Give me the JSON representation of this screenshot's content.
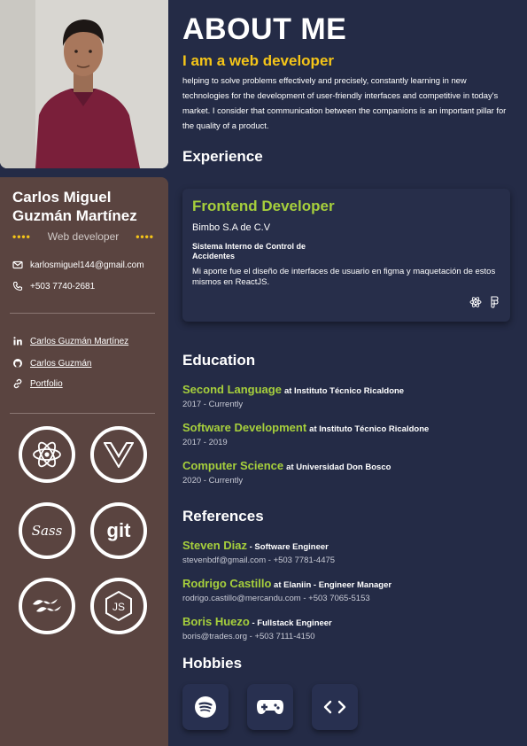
{
  "profile": {
    "name": "Carlos Miguel Guzmán Martínez",
    "role": "Web developer",
    "dots": "••••",
    "email": "karlosmiguel144@gmail.com",
    "phone": "+503 7740-2681"
  },
  "links": {
    "linkedin": "Carlos Guzmán Martínez",
    "github": "Carlos Guzmán",
    "portfolio": "Portfolio"
  },
  "tech_icons": [
    "react-icon",
    "vue-icon",
    "sass-icon",
    "git-icon",
    "tailwind-icon",
    "nodejs-icon"
  ],
  "about": {
    "title": "ABOUT ME",
    "tagline": "I am a web developer",
    "text": "helping to solve problems effectively and precisely, constantly learning in new technologies for the development of user-friendly interfaces and competitive in today's market. I consider that communication between the companions is an important pillar for the quality of a product."
  },
  "experience": {
    "title": "Experience",
    "job_title": "Frontend Developer",
    "company": "Bimbo S.A de C.V",
    "project": "Sistema Interno de Control de Accidentes",
    "description": "Mi aporte fue el diseño de interfaces de usuario en figma y maquetación de estos mismos en ReactJS."
  },
  "education": {
    "title": "Education",
    "items": [
      {
        "title": "Second Language",
        "at": "at Instituto Técnico Ricaldone",
        "dates": "2017 - Currently"
      },
      {
        "title": "Software Development",
        "at": "at Instituto Técnico Ricaldone",
        "dates": "2017 - 2019"
      },
      {
        "title": "Computer Science",
        "at": "at Universidad Don Bosco",
        "dates": "2020 - Currently"
      }
    ]
  },
  "references": {
    "title": "References",
    "items": [
      {
        "name": "Steven Diaz",
        "role": " - Software Engineer",
        "contact": "stevenbdf@gmail.com -  +503 7781-4475"
      },
      {
        "name": "Rodrigo Castillo",
        "role": " at Elaniin - Engineer Manager",
        "contact": "rodrigo.castillo@mercandu.com -  +503 7065-5153"
      },
      {
        "name": "Boris Huezo",
        "role": " - Fullstack Engineer",
        "contact": "boris@trades.org - +503 7111-4150"
      }
    ]
  },
  "hobbies": {
    "title": "Hobbies",
    "icons": [
      "spotify-icon",
      "gamepad-icon",
      "code-icon"
    ]
  },
  "colors": {
    "background": "#242b46",
    "sidebar": "#5a4440",
    "accent_green": "#a6cf3c",
    "accent_yellow": "#f5c518"
  }
}
